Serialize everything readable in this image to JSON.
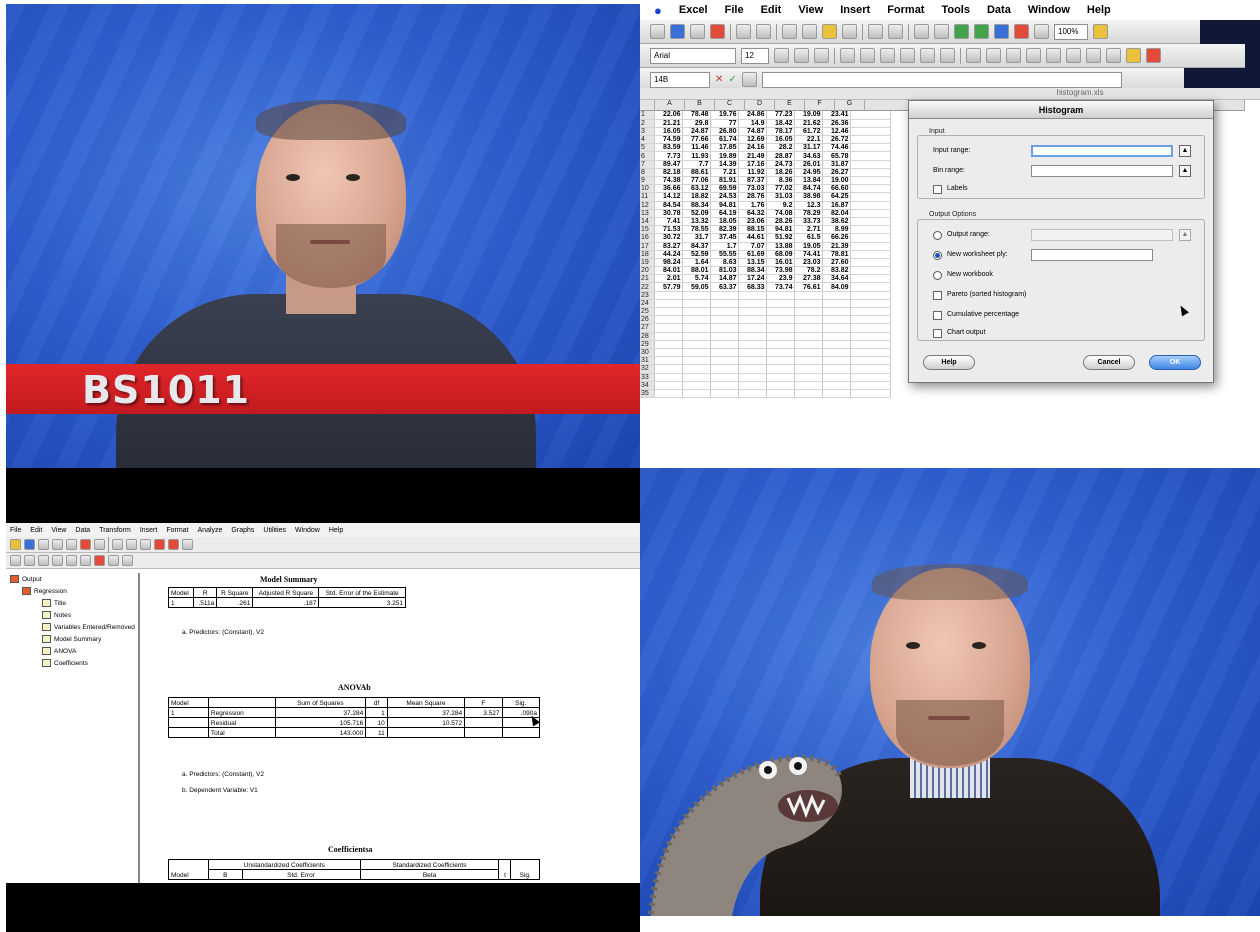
{
  "top_left_video": {
    "caption": "BS1011",
    "colors": {
      "background": "#2f5fd0",
      "banner": "#d42024",
      "caption_text": "#e8e8ec"
    }
  },
  "excel": {
    "menu": [
      "Excel",
      "File",
      "Edit",
      "View",
      "Insert",
      "Format",
      "Tools",
      "Data",
      "Window",
      "Help"
    ],
    "font_name": "Arial",
    "font_size": "12",
    "zoom": "100%",
    "name_box": "14B",
    "window_title": "histogram.xls",
    "columns": [
      "A",
      "B",
      "C",
      "D",
      "E",
      "F",
      "G",
      "H"
    ],
    "rows": [
      [
        "22.06",
        "78.48",
        "19.76",
        "24.86",
        "77.23",
        "19.09",
        "23.41"
      ],
      [
        "21.21",
        "29.8",
        "77",
        "14.9",
        "18.42",
        "21.62",
        "26.36"
      ],
      [
        "16.05",
        "24.87",
        "26.80",
        "74.87",
        "78.17",
        "61.72",
        "12.46"
      ],
      [
        "74.59",
        "77.66",
        "61.74",
        "12.69",
        "16.05",
        "22.1",
        "26.72"
      ],
      [
        "83.59",
        "11.46",
        "17.85",
        "24.16",
        "28.2",
        "31.17",
        "74.46"
      ],
      [
        "7.73",
        "11.93",
        "19.89",
        "21.49",
        "28.87",
        "34.63",
        "65.78"
      ],
      [
        "89.47",
        "7.7",
        "14.39",
        "17.16",
        "24.73",
        "26.01",
        "31.87"
      ],
      [
        "82.18",
        "88.61",
        "7.21",
        "11.92",
        "18.26",
        "24.95",
        "26.27"
      ],
      [
        "74.38",
        "77.06",
        "81.91",
        "87.37",
        "8.36",
        "13.84",
        "19.00"
      ],
      [
        "36.66",
        "63.12",
        "69.59",
        "73.03",
        "77.02",
        "84.74",
        "66.60"
      ],
      [
        "14.12",
        "18.82",
        "24.53",
        "28.76",
        "31.03",
        "38.98",
        "64.25"
      ],
      [
        "84.54",
        "88.34",
        "94.81",
        "1.76",
        "9.2",
        "12.3",
        "16.87"
      ],
      [
        "30.78",
        "52.09",
        "64.19",
        "64.32",
        "74.08",
        "78.29",
        "82.04"
      ],
      [
        "7.41",
        "13.32",
        "18.05",
        "23.06",
        "28.26",
        "33.73",
        "38.62"
      ],
      [
        "71.53",
        "78.55",
        "82.39",
        "88.15",
        "94.81",
        "2.71",
        "8.99"
      ],
      [
        "30.72",
        "31.7",
        "37.45",
        "44.61",
        "51.92",
        "61.5",
        "66.26"
      ],
      [
        "83.27",
        "84.37",
        "1.7",
        "7.07",
        "13.88",
        "19.05",
        "21.39"
      ],
      [
        "44.24",
        "52.59",
        "55.55",
        "61.69",
        "68.09",
        "74.41",
        "78.81"
      ],
      [
        "98.24",
        "1.64",
        "8.63",
        "13.15",
        "16.01",
        "23.03",
        "27.60"
      ],
      [
        "84.01",
        "88.01",
        "81.03",
        "88.34",
        "73.98",
        "78.2",
        "83.82"
      ],
      [
        "2.01",
        "5.74",
        "14.87",
        "17.24",
        "23.9",
        "27.38",
        "34.64"
      ],
      [
        "57.79",
        "59.05",
        "63.37",
        "68.33",
        "73.74",
        "76.61",
        "84.09"
      ]
    ],
    "row_count": 35,
    "dialog": {
      "title": "Histogram",
      "input_group": "Input",
      "input_range_label": "Input range:",
      "bin_range_label": "Bin range:",
      "labels_label": "Labels",
      "output_group": "Output Options",
      "output_range_label": "Output range:",
      "new_ply_label": "New worksheet ply:",
      "new_workbook_label": "New workbook",
      "pareto_label": "Pareto (sorted histogram)",
      "cumulative_label": "Cumulative percentage",
      "chart_label": "Chart output",
      "help_button": "Help",
      "cancel_button": "Cancel",
      "ok_button": "OK"
    }
  },
  "spss": {
    "menu": [
      "File",
      "Edit",
      "View",
      "Data",
      "Transform",
      "Insert",
      "Format",
      "Analyze",
      "Graphs",
      "Utilities",
      "Window",
      "Help"
    ],
    "outline": [
      "Output",
      "Regression",
      "Title",
      "Notes",
      "Variables Entered/Removed",
      "Model Summary",
      "ANOVA",
      "Coefficients"
    ],
    "model_summary": {
      "title": "Model Summary",
      "headers": [
        "Model",
        "R",
        "R Square",
        "Adjusted R Square",
        "Std. Error of the Estimate"
      ],
      "row": [
        "1",
        ".511a",
        ".261",
        ".187",
        "3.251"
      ],
      "footnote": "a. Predictors: (Constant), V2"
    },
    "anova": {
      "title": "ANOVAb",
      "headers": [
        "Model",
        "",
        "Sum of Squares",
        "df",
        "Mean Square",
        "F",
        "Sig."
      ],
      "rows": [
        [
          "1",
          "Regression",
          "37.284",
          "1",
          "37.284",
          "3.527",
          ".090a"
        ],
        [
          "",
          "Residual",
          "105.716",
          "10",
          "10.572",
          "",
          ""
        ],
        [
          "",
          "Total",
          "143.000",
          "11",
          "",
          "",
          ""
        ]
      ],
      "footnote_a": "a. Predictors: (Constant), V2",
      "footnote_b": "b. Dependent Variable: V1"
    },
    "coefficients": {
      "title": "Coefficientsa",
      "group1": "Unstandardized Coefficients",
      "group2": "Standardized Coefficients",
      "headers": [
        "Model",
        "B",
        "Std. Error",
        "Beta",
        "t",
        "Sig."
      ]
    }
  }
}
